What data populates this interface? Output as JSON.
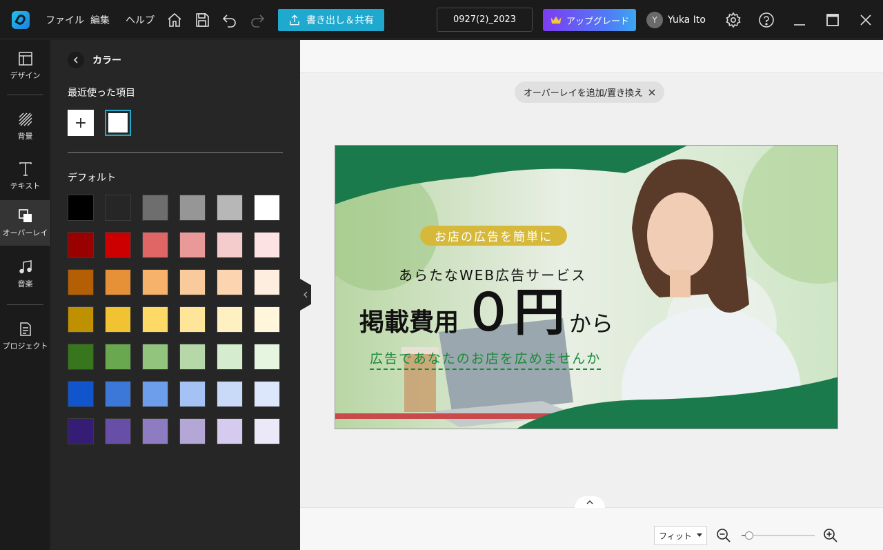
{
  "menu": {
    "file": "ファイル",
    "edit": "編集",
    "help": "ヘルプ"
  },
  "toolbar": {
    "export_label": "書き出し＆共有",
    "project_name": "0927(2)_2023",
    "upgrade_label": "アップグレード",
    "avatar_initial": "Y",
    "username": "Yuka Ito"
  },
  "rail": {
    "design": "デザイン",
    "background": "背景",
    "text": "テキスト",
    "overlay": "オーバーレイ",
    "music": "音楽",
    "project": "プロジェクト"
  },
  "panel": {
    "title": "カラー",
    "recent_label": "最近使った項目",
    "add_label": "+",
    "default_label": "デフォルト",
    "swatches": [
      [
        "#000000",
        "#262626",
        "#6e6e6e",
        "#969696",
        "#b7b7b7",
        "#ffffff"
      ],
      [
        "#990000",
        "#cc0000",
        "#e06666",
        "#ea9999",
        "#f4cccc",
        "#fde2e4"
      ],
      [
        "#b45f06",
        "#e69138",
        "#f6b26b",
        "#f9cb9c",
        "#fcd5b0",
        "#fdeee0"
      ],
      [
        "#bf9000",
        "#f1c232",
        "#ffd966",
        "#ffe599",
        "#fff0c2",
        "#fff6db"
      ],
      [
        "#38761d",
        "#6aa84f",
        "#93c47d",
        "#b6d7a8",
        "#d5ecce",
        "#e6f5e0"
      ],
      [
        "#1155cc",
        "#3c78d8",
        "#6d9eeb",
        "#a4c2f4",
        "#c9daf8",
        "#dde7fb"
      ],
      [
        "#351c75",
        "#674ea7",
        "#8e7cc3",
        "#b4a7d6",
        "#d4cbee",
        "#ebe8f8"
      ]
    ]
  },
  "canvas": {
    "overlay_chip": "オーバーレイを追加/置き換え",
    "banner": {
      "tag": "お店の広告を簡単に",
      "subtitle": "あらたなWEB広告サービス",
      "headline_pre": "掲載費用",
      "headline_big": "０円",
      "headline_post": "から",
      "cta": "広告であなたのお店を広めませんか"
    }
  },
  "zoom": {
    "mode": "フィット",
    "level": 0.1
  },
  "colors": {
    "accent": "#1fa9cf",
    "banner_green": "#1a7a4c"
  }
}
